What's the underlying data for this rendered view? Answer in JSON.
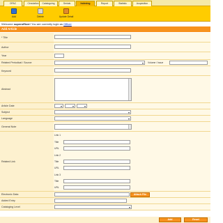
{
  "tabs": [
    {
      "label": "OPAC"
    },
    {
      "label": "Circulation"
    },
    {
      "label": "Cataloguing"
    },
    {
      "label": "Serials"
    },
    {
      "label": "Indexing"
    },
    {
      "label": "Report"
    },
    {
      "label": "Statistic"
    },
    {
      "label": "Acquisition"
    }
  ],
  "active_tab": "Indexing",
  "toolbar": [
    {
      "label": "Add",
      "icon": "add-icon"
    },
    {
      "label": "Delete",
      "icon": "delete-icon"
    },
    {
      "label": "Update Detail",
      "icon": "update-icon"
    }
  ],
  "welcome": {
    "prefix": "Welcome",
    "user": "superofficer",
    "middle": "You are currently login as",
    "role": "Officer"
  },
  "section_title": "Add Article",
  "fields": {
    "title": "* Title",
    "author": "Author",
    "year": "Year",
    "related_periodical": "Related Periodical / Source",
    "volume_issue": "Volume / Issue",
    "keyword": "Keyword",
    "abstract": "Abstract",
    "article_date": "Article Date",
    "subject": "Subject",
    "language": "Language",
    "general_note": "General Note",
    "related_link": "Related Link",
    "electronic_data": "Electronic Data",
    "added_entry": "Added Entry",
    "cataloging_level": "Cataloging Level"
  },
  "links": [
    {
      "heading": "Link 1",
      "title": "Title",
      "url": "URL"
    },
    {
      "heading": "Link 2",
      "title": "Title",
      "url": "URL"
    },
    {
      "heading": "Link 3",
      "title": "Title",
      "url": "URL"
    }
  ],
  "buttons": {
    "attach": "Attach File",
    "add": "Add",
    "reset": "Reset"
  },
  "colors": {
    "accent": "#f7921e",
    "toolbar": "#ffcc00",
    "label_bg": "#fdf1cf"
  }
}
